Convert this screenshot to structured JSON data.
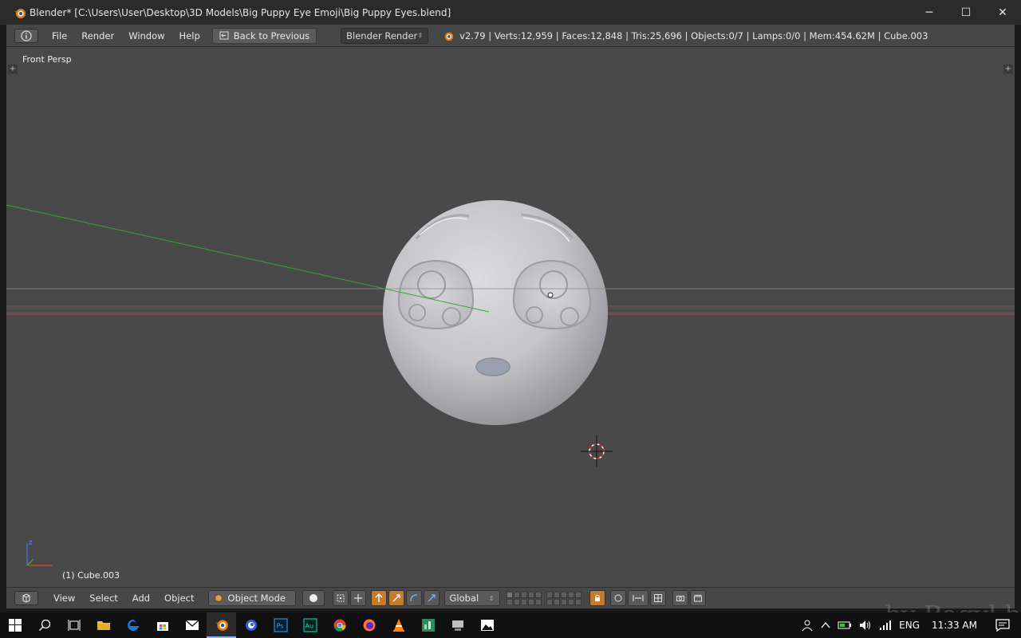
{
  "window": {
    "title": "Blender* [C:\\Users\\User\\Desktop\\3D Models\\Big Puppy Eye Emoji\\Big Puppy Eyes.blend]",
    "minimize": "─",
    "maximize": "☐",
    "close": "✕"
  },
  "info_header": {
    "menus": [
      "File",
      "Render",
      "Window",
      "Help"
    ],
    "back_button": "Back to Previous",
    "render_engine": "Blender Render",
    "stats": "v2.79 | Verts:12,959 | Faces:12,848 | Tris:25,696 | Objects:0/7 | Lamps:0/0 | Mem:454.62M | Cube.003"
  },
  "viewport": {
    "view_name": "Front Persp",
    "active_object": "(1) Cube.003",
    "axis_labels": {
      "z": "z"
    }
  },
  "view_header": {
    "menus": [
      "View",
      "Select",
      "Add",
      "Object"
    ],
    "mode": "Object Mode",
    "orientation": "Global"
  },
  "taskbar": {
    "language": "ENG",
    "time": "11:33 AM",
    "apps": [
      "start",
      "search",
      "task-view",
      "file-explorer",
      "edge",
      "store",
      "mail",
      "blender",
      "cinema4d",
      "photoshop",
      "audition",
      "chrome",
      "firefox",
      "vlc",
      "money",
      "devices",
      "photos"
    ],
    "active_app": "blender"
  },
  "watermark": "by Bagyl.b",
  "colors": {
    "viewport_bg": "#494949",
    "header_bg": "#474747",
    "accent": "#c57b2e",
    "x_axis": "#d04040",
    "y_axis": "#3aa53a"
  }
}
